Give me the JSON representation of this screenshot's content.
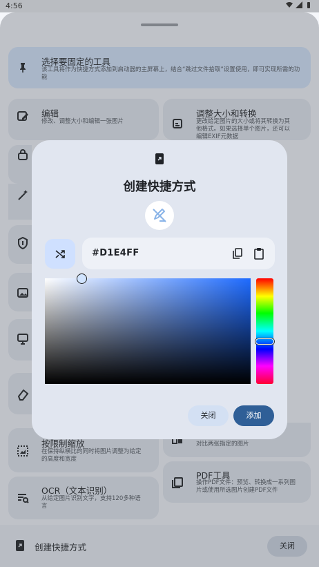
{
  "statusbar": {
    "time": "4:56"
  },
  "background": {
    "pinned": {
      "title": "选择要固定的工具",
      "description": "该工具将作为快捷方式添加到启动器的主屏幕上，结合“跳过文件拾取”设置使用，即可实现所需的功能"
    },
    "tools_left": [
      {
        "title": "编辑",
        "description": "修改、调整大小和编辑一张图片"
      },
      {
        "title": "按限制缩放",
        "description": "在保持纵横比的同时将图片调整为给定的高度和宽度"
      },
      {
        "title": "OCR（文本识别）",
        "description": "从给定图片识别文字，支持120多种语言"
      }
    ],
    "tools_right": [
      {
        "title": "调整大小和转换",
        "description": "更改给定图片的大小或将其转换为其他格式。如果选择单个图片，还可以编辑EXIF元数据"
      },
      {
        "title": "",
        "description": "对比两张指定的图片"
      },
      {
        "title": "PDF工具",
        "description": "操作PDF文件：预览、转换成一系列图片或使用所选图片创建PDF文件"
      }
    ]
  },
  "bottom_bar": {
    "title": "创建快捷方式",
    "close_label": "关闭"
  },
  "dialog": {
    "title": "创建快捷方式",
    "hex_value": "#D1E4FF",
    "selected_color": "#D1E4FF",
    "hue_color": "#1E6BFF",
    "close_label": "关闭",
    "add_label": "添加"
  },
  "colors": {
    "primary": "#2F5F97",
    "tonal": "#D3E0F3",
    "dialog_surface": "#E1E6F0"
  }
}
